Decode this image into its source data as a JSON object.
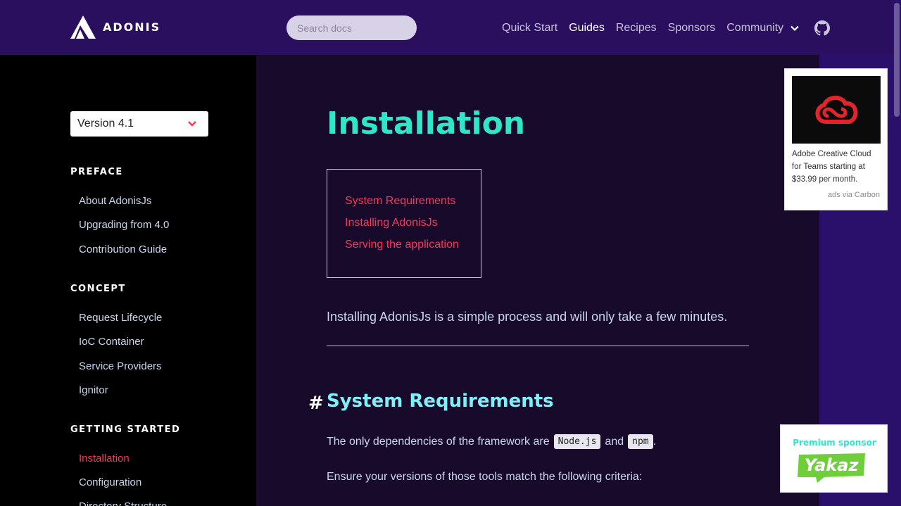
{
  "header": {
    "logo_text": "ADONIS",
    "search_placeholder": "Search docs",
    "nav": [
      {
        "label": "Quick Start",
        "active": false
      },
      {
        "label": "Guides",
        "active": true
      },
      {
        "label": "Recipes",
        "active": false
      },
      {
        "label": "Sponsors",
        "active": false
      },
      {
        "label": "Community",
        "active": false
      }
    ],
    "icons": {
      "community_dropdown": "chevron-down-icon",
      "github": "github-icon"
    }
  },
  "sidebar": {
    "version": "Version 4.1",
    "sections": [
      {
        "title": "PREFACE",
        "items": [
          "About AdonisJs",
          "Upgrading from 4.0",
          "Contribution Guide"
        ]
      },
      {
        "title": "CONCEPT",
        "items": [
          "Request Lifecycle",
          "IoC Container",
          "Service Providers",
          "Ignitor"
        ]
      },
      {
        "title": "GETTING STARTED",
        "items": [
          "Installation",
          "Configuration",
          "Directory Structure"
        ]
      }
    ],
    "active_item": "Installation"
  },
  "main": {
    "title": "Installation",
    "toc": [
      "System Requirements",
      "Installing AdonisJs",
      "Serving the application"
    ],
    "intro": "Installing AdonisJs is a simple process and will only take a few minutes.",
    "section_hash": "#",
    "section_title": "System Requirements",
    "p1_before": "The only dependencies of the framework are",
    "p1_code1": "Node.js",
    "p1_and": "and",
    "p1_code2": "npm",
    "p1_end": ".",
    "p2": "Ensure your versions of those tools match the following criteria:"
  },
  "ad": {
    "text": "Adobe Creative Cloud for Teams starting at $33.99 per month.",
    "via": "ads via Carbon"
  },
  "sponsor": {
    "label": "Premium sponsor",
    "logo_text": "Yakaz"
  },
  "colors": {
    "accent": "#f73859",
    "title": "#2ee6c8",
    "header_bg": "#2a0f5e",
    "main_bg": "#180a2a"
  }
}
